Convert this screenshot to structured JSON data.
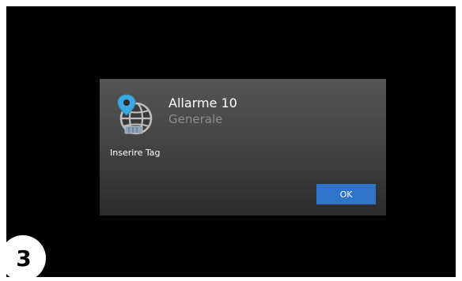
{
  "dialog": {
    "icon": "globe-location-pin-icon",
    "title": "Allarme 10",
    "subtitle": "Generale",
    "message": "Inserire Tag",
    "ok_label": "OK"
  },
  "step_badge": {
    "number": "3"
  },
  "colors": {
    "screen_background": "#000000",
    "dialog_background": "#474747",
    "button_primary": "#2e74c9",
    "subtitle_text": "#8c8c8c",
    "pin_accent": "#3da8e0"
  }
}
